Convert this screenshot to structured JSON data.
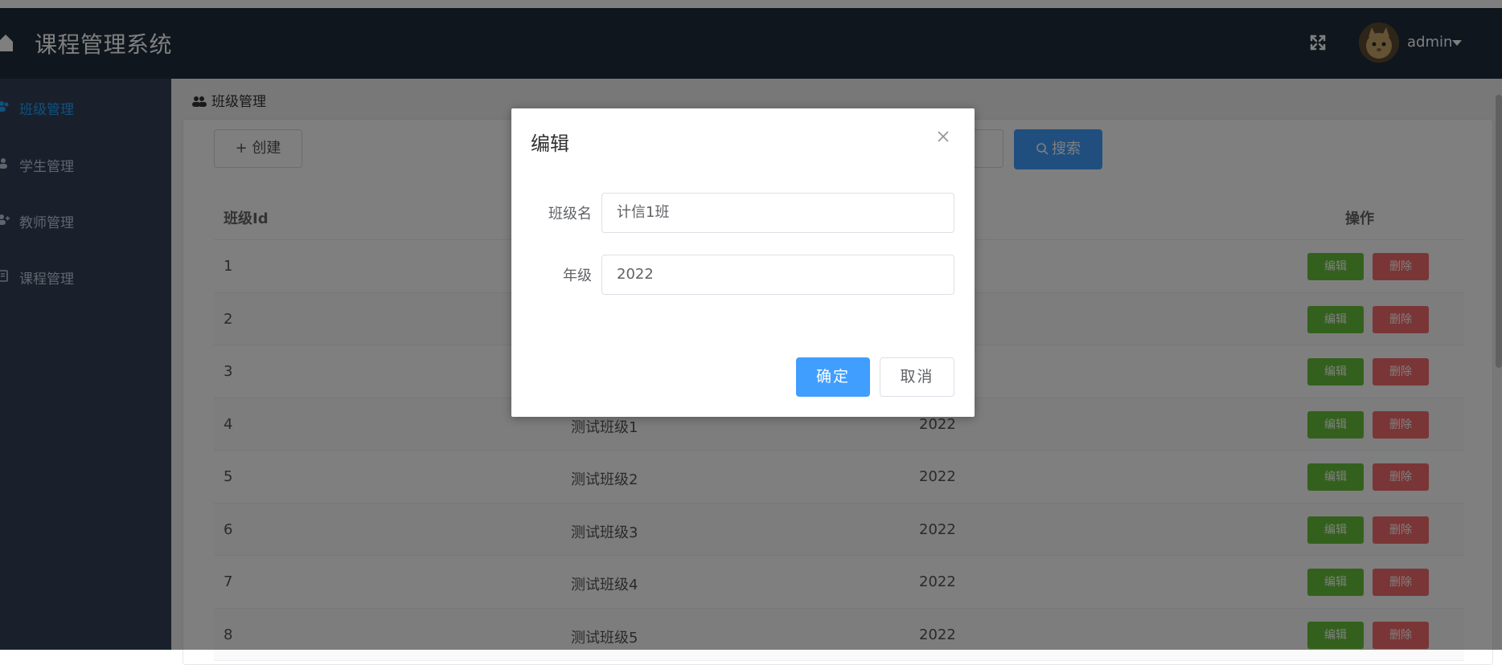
{
  "header": {
    "title": "课程管理系统",
    "user_name": "admin"
  },
  "sidebar": {
    "items": [
      {
        "label": "班级管理",
        "icon": "users-icon"
      },
      {
        "label": "学生管理",
        "icon": "user-icon"
      },
      {
        "label": "教师管理",
        "icon": "user-plus-icon"
      },
      {
        "label": "课程管理",
        "icon": "book-icon"
      }
    ]
  },
  "main": {
    "breadcrumb": "班级管理",
    "create_label": "+ 创建",
    "search_label": "搜索",
    "table": {
      "headers": {
        "id": "班级Id",
        "action": "操作"
      },
      "rows": [
        {
          "id": "1",
          "name": "",
          "grade": ""
        },
        {
          "id": "2",
          "name": "",
          "grade": ""
        },
        {
          "id": "3",
          "name": "",
          "grade": ""
        },
        {
          "id": "4",
          "name": "测试班级1",
          "grade": "2022"
        },
        {
          "id": "5",
          "name": "测试班级2",
          "grade": "2022"
        },
        {
          "id": "6",
          "name": "测试班级3",
          "grade": "2022"
        },
        {
          "id": "7",
          "name": "测试班级4",
          "grade": "2022"
        },
        {
          "id": "8",
          "name": "测试班级5",
          "grade": "2022"
        }
      ],
      "edit_label": "编辑",
      "delete_label": "删除"
    }
  },
  "modal": {
    "title": "编辑",
    "fields": {
      "class_name_label": "班级名",
      "class_name_value": "计信1班",
      "grade_label": "年级",
      "grade_value": "2022"
    },
    "confirm_label": "确定",
    "cancel_label": "取消"
  },
  "colors": {
    "header_bg": "#1f2d3d",
    "sidebar_bg": "#324157",
    "active": "#20a0ff",
    "primary": "#409eff",
    "success": "#67c23a",
    "danger": "#f56c6c"
  }
}
